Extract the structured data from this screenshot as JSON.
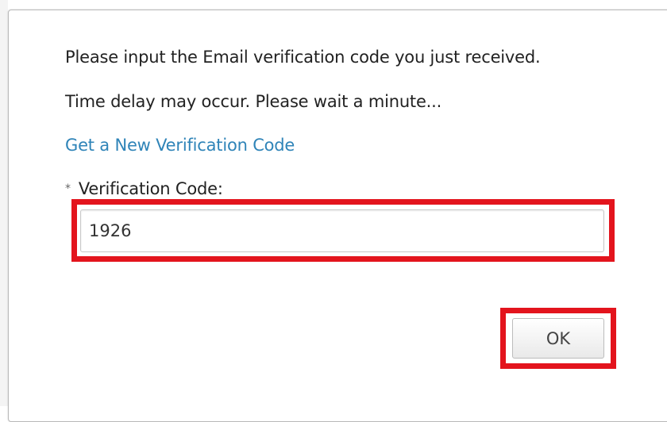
{
  "dialog": {
    "message_line1": "Please input the Email verification code you just received.",
    "message_line2": "Time delay may occur. Please wait a minute...",
    "new_code_link": "Get a New Verification Code",
    "required_marker": "*",
    "field_label": "Verification Code:",
    "code_value": "1926",
    "ok_label": "OK"
  },
  "colors": {
    "link": "#2f84b8",
    "highlight": "#e3141d",
    "text": "#222222"
  }
}
